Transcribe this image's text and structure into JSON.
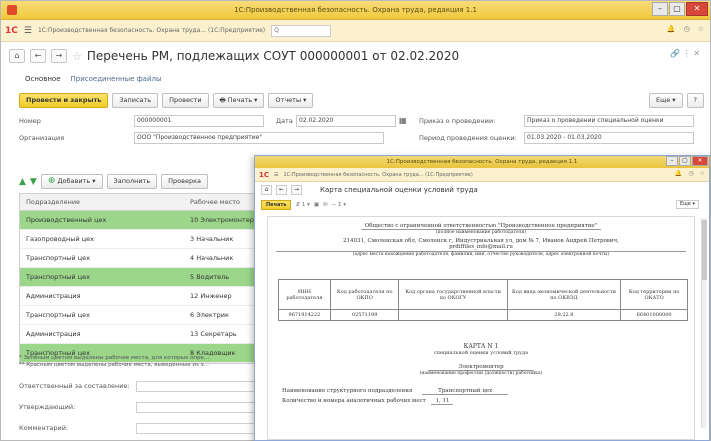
{
  "main_window": {
    "title": "1С:Производственная безопасность. Охрана труда, редакция 1.1",
    "menu_text": "1С:Производственная безопасность. Охрана труда... (1С:Предприятие)"
  },
  "document": {
    "title": "Перечень РМ, подлежащих СОУТ 000000001 от 02.02.2020",
    "tabs": [
      "Основное",
      "Присоединенные файлы"
    ]
  },
  "toolbar": {
    "post_close": "Провести и закрыть",
    "write": "Записать",
    "post": "Провести",
    "print": "Печать",
    "reports": "Отчеты",
    "more": "Еще",
    "help": "?"
  },
  "fields": {
    "number_label": "Номер",
    "number_value": "000000001",
    "date_label": "Дата",
    "date_value": "02.02.2020",
    "order_label": "Приказ о проведении:",
    "order_value": "Приказ о проведении специальной оценки",
    "org_label": "Организация",
    "org_value": "ООО \"Производственное предприятие\"",
    "period_label": "Период проведения оценки:",
    "period_value": "01.03.2020 - 01.03.2020"
  },
  "table_toolbar": {
    "add": "Добавить",
    "fill": "Заполнить",
    "check": "Проверка"
  },
  "grid": {
    "col1": "Подразделение",
    "col2": "Рабочее место",
    "rows": [
      {
        "dept": "Производственный цех",
        "place": "10 Электромонтер",
        "hl": true
      },
      {
        "dept": "Газопроводный цех",
        "place": "3 Начальник",
        "hl": false
      },
      {
        "dept": "Транспортный цех",
        "place": "4 Начальник",
        "hl": false
      },
      {
        "dept": "Транспортный цех",
        "place": "5 Водитель",
        "hl": true
      },
      {
        "dept": "Администрация",
        "place": "12 Инженер",
        "hl": false
      },
      {
        "dept": "Транспортный цех",
        "place": "6 Электрик",
        "hl": false
      },
      {
        "dept": "Администрация",
        "place": "13 Секретарь",
        "hl": false
      },
      {
        "dept": "Транспортный цех",
        "place": "8 Кладовщик",
        "hl": true
      }
    ]
  },
  "footnotes": [
    "* Зелёным цветом выделены рабочие места, для которых опре...",
    "** Красным цветом выделены рабочие места, выведенные из э..."
  ],
  "bottom_fields": {
    "responsible": "Ответственный за составление:",
    "approver": "Утверждающий:",
    "comment": "Комментарий:"
  },
  "popup": {
    "title": "1С:Производственная безопасность. Охрана труда, редакция 1.1",
    "menu_text": "1С:Производственная безопасность. Охрана труда... (1С:Предприятие)",
    "doc_title": "Карта специальной оценки условий труда",
    "print_btn": "Печать",
    "more": "Еще"
  },
  "report": {
    "org_line": "Общество с ограниченной ответственностью \"Производственное предприятие\"",
    "org_sub": "(полное наименование работодателя)",
    "address_line": "214031, Смоленская обл, Смоленск г, Индустриальная ул, дом № 7, Иванов Андрей Петрович,",
    "email_line": "prdiffiles_info@mail.ru",
    "address_sub": "(адрес места нахождения работодателя, фамилия, имя, отчество руководителя, адрес электронной почты)",
    "table_headers": [
      "ИНН работодателя",
      "Код работодателя по ОКПО",
      "Код органа государственной власти по ОКОГУ",
      "Код вида экономической деятельности по ОКВЭД",
      "Код территории по ОКАТО"
    ],
    "table_values": [
      "9671914222",
      "02571199",
      "",
      "28.22.8",
      "66401000000"
    ],
    "card_title": "КАРТА N 1",
    "card_sub": "специальной оценки условий труда",
    "profession": "Электромонтер",
    "profession_sub": "(наименование профессии (должности) работника)",
    "unit_label": "Наименование структурного подразделения",
    "unit_value": "Транспортный цех",
    "count_label": "Количество и номера аналогичных рабочих мест",
    "count_value": "1, 11"
  }
}
